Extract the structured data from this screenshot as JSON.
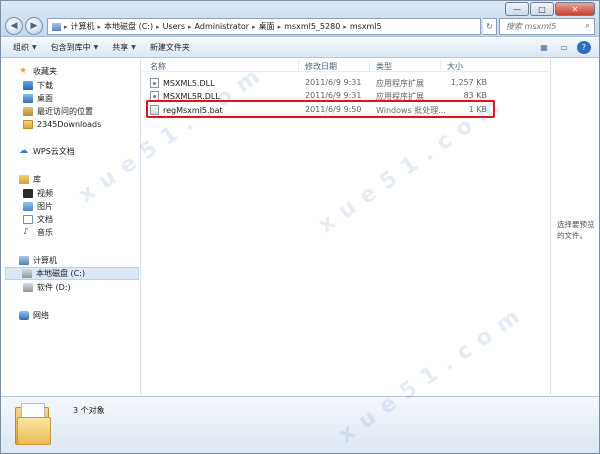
{
  "window": {
    "controls": {
      "minimize": "—",
      "maximize": "□",
      "close": "✕"
    }
  },
  "address": {
    "breadcrumbs": [
      "计算机",
      "本地磁盘 (C:)",
      "Users",
      "Administrator",
      "桌面",
      "msxml5_5280",
      "msxml5"
    ]
  },
  "search": {
    "placeholder": "搜索 msxml5"
  },
  "toolbar": {
    "organize": "组织",
    "include_in_library": "包含到库中",
    "share": "共享",
    "new_folder": "新建文件夹"
  },
  "sidebar": {
    "favorites": "收藏夹",
    "downloads": "下载",
    "desktop": "桌面",
    "recent": "最近访问的位置",
    "downloads2345": "2345Downloads",
    "wps_cloud": "WPS云文档",
    "libraries": "库",
    "videos": "视频",
    "pictures": "图片",
    "documents": "文档",
    "music": "音乐",
    "computer": "计算机",
    "drive_c": "本地磁盘 (C:)",
    "drive_d": "软件 (D:)",
    "network": "网络"
  },
  "columns": {
    "name": "名称",
    "date": "修改日期",
    "type": "类型",
    "size": "大小"
  },
  "files": [
    {
      "name": "MSXML5.DLL",
      "date": "2011/6/9 9:31",
      "type": "应用程序扩展",
      "size": "1,257 KB"
    },
    {
      "name": "MSXML5R.DLL",
      "date": "2011/6/9 9:31",
      "type": "应用程序扩展",
      "size": "83 KB"
    },
    {
      "name": "regMsxml5.bat",
      "date": "2011/6/9 9:50",
      "type": "Windows 批处理...",
      "size": "1 KB"
    }
  ],
  "preview": {
    "text": "选择要预览的文件。"
  },
  "details": {
    "count": "3 个对象"
  },
  "colors": {
    "highlight": "#e0141e",
    "accent": "#3b6aa0"
  }
}
